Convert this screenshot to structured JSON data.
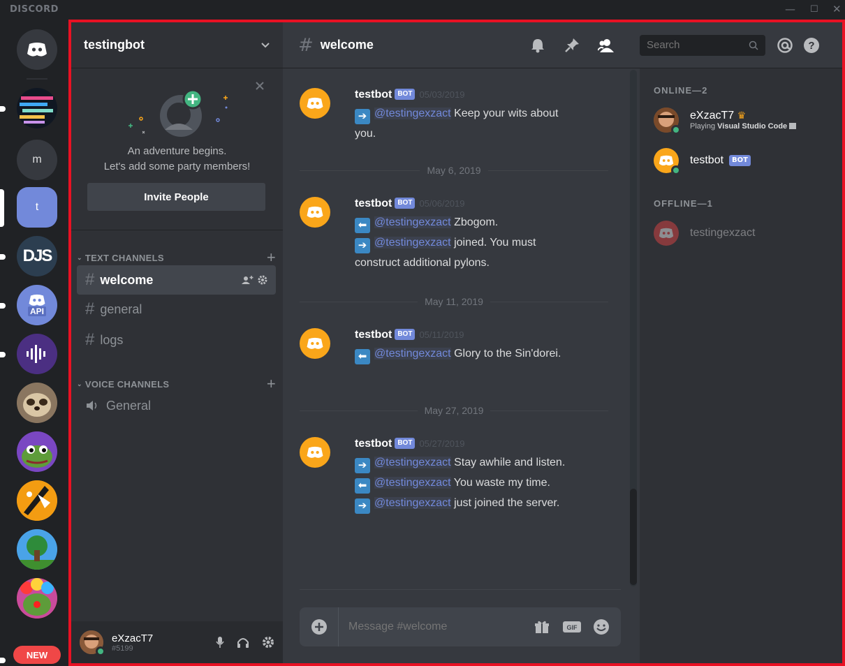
{
  "window": {
    "brand": "DISCORD",
    "minimize": "—",
    "maximize": "☐",
    "close": "✕"
  },
  "guilds": [
    {
      "label": "",
      "type": "home"
    },
    {
      "label": "",
      "type": "image"
    },
    {
      "label": "m",
      "type": "letter"
    },
    {
      "label": "t",
      "type": "letter-active"
    },
    {
      "label": "DJS",
      "type": "image"
    },
    {
      "label": "API",
      "type": "image"
    },
    {
      "label": "",
      "type": "image"
    },
    {
      "label": "",
      "type": "image"
    },
    {
      "label": "",
      "type": "image"
    },
    {
      "label": "",
      "type": "image"
    },
    {
      "label": "",
      "type": "image"
    },
    {
      "label": "",
      "type": "image"
    }
  ],
  "new_badge": "NEW",
  "server": {
    "name": "testingbot"
  },
  "invite": {
    "line1": "An adventure begins.",
    "line2": "Let's add some party members!",
    "button": "Invite People"
  },
  "categories": {
    "text": "TEXT CHANNELS",
    "voice": "VOICE CHANNELS"
  },
  "channels": {
    "welcome": "welcome",
    "general": "general",
    "logs": "logs",
    "voice_general": "General"
  },
  "user": {
    "name": "eXzacT7",
    "tag": "#5199"
  },
  "chat": {
    "channel": "welcome",
    "placeholder": "Message #welcome"
  },
  "messages": [
    {
      "author": "testbot",
      "badge": "BOT",
      "time": "05/03/2019",
      "lines": [
        {
          "dir": "in",
          "mention": "@testingexzact",
          "text": " Keep your wits about you."
        }
      ]
    },
    {
      "author": "testbot",
      "badge": "BOT",
      "time": "05/06/2019",
      "lines": [
        {
          "dir": "out",
          "mention": "@testingexzact",
          "text": " Zbogom."
        },
        {
          "dir": "in",
          "mention": "@testingexzact",
          "text": " joined. You must construct additional pylons."
        }
      ]
    },
    {
      "author": "testbot",
      "badge": "BOT",
      "time": "05/11/2019",
      "lines": [
        {
          "dir": "out",
          "mention": "@testingexzact",
          "text": " Glory to the Sin'dorei."
        }
      ]
    },
    {
      "author": "testbot",
      "badge": "BOT",
      "time": "05/27/2019",
      "lines": [
        {
          "dir": "in",
          "mention": "@testingexzact",
          "text": " Stay awhile and listen."
        },
        {
          "dir": "out",
          "mention": "@testingexzact",
          "text": " You waste my time."
        },
        {
          "dir": "in",
          "mention": "@testingexzact",
          "text": " just joined the server."
        }
      ]
    }
  ],
  "dividers": [
    "May 6, 2019",
    "May 11, 2019",
    "May 27, 2019"
  ],
  "search": {
    "placeholder": "Search"
  },
  "members": {
    "online_header": "ONLINE—2",
    "offline_header": "OFFLINE—1",
    "online": [
      {
        "name": "eXzacT7",
        "activity_prefix": "Playing ",
        "activity": "Visual Studio Code"
      },
      {
        "name": "testbot",
        "badge": "BOT"
      }
    ],
    "offline": [
      {
        "name": "testingexzact"
      }
    ]
  },
  "colors": {
    "accent": "#7289da",
    "online": "#43b581",
    "bot_avatar": "#faa61a",
    "frame": "#e81123"
  }
}
